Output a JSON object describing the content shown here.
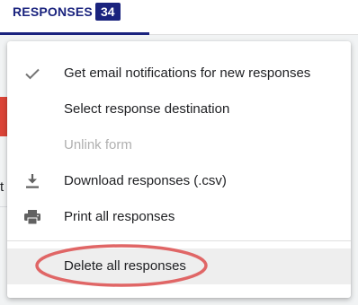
{
  "tabs": {
    "responses_label": "RESPONSES",
    "responses_count": "34"
  },
  "background": {
    "partial_text": "t"
  },
  "menu": {
    "items": [
      {
        "label": "Get email notifications for new responses",
        "icon": "check-icon",
        "enabled": true,
        "checked": true
      },
      {
        "label": "Select response destination",
        "icon": "",
        "enabled": true
      },
      {
        "label": "Unlink form",
        "icon": "",
        "enabled": false
      },
      {
        "label": "Download responses (.csv)",
        "icon": "download-icon",
        "enabled": true
      },
      {
        "label": "Print all responses",
        "icon": "print-icon",
        "enabled": true
      },
      {
        "label": "Delete all responses",
        "icon": "",
        "enabled": true,
        "highlighted": true
      }
    ]
  },
  "colors": {
    "accent": "#1a237e",
    "annotation": "#e06666",
    "red_strip": "#db4437",
    "disabled_text": "#b0b0b0"
  }
}
